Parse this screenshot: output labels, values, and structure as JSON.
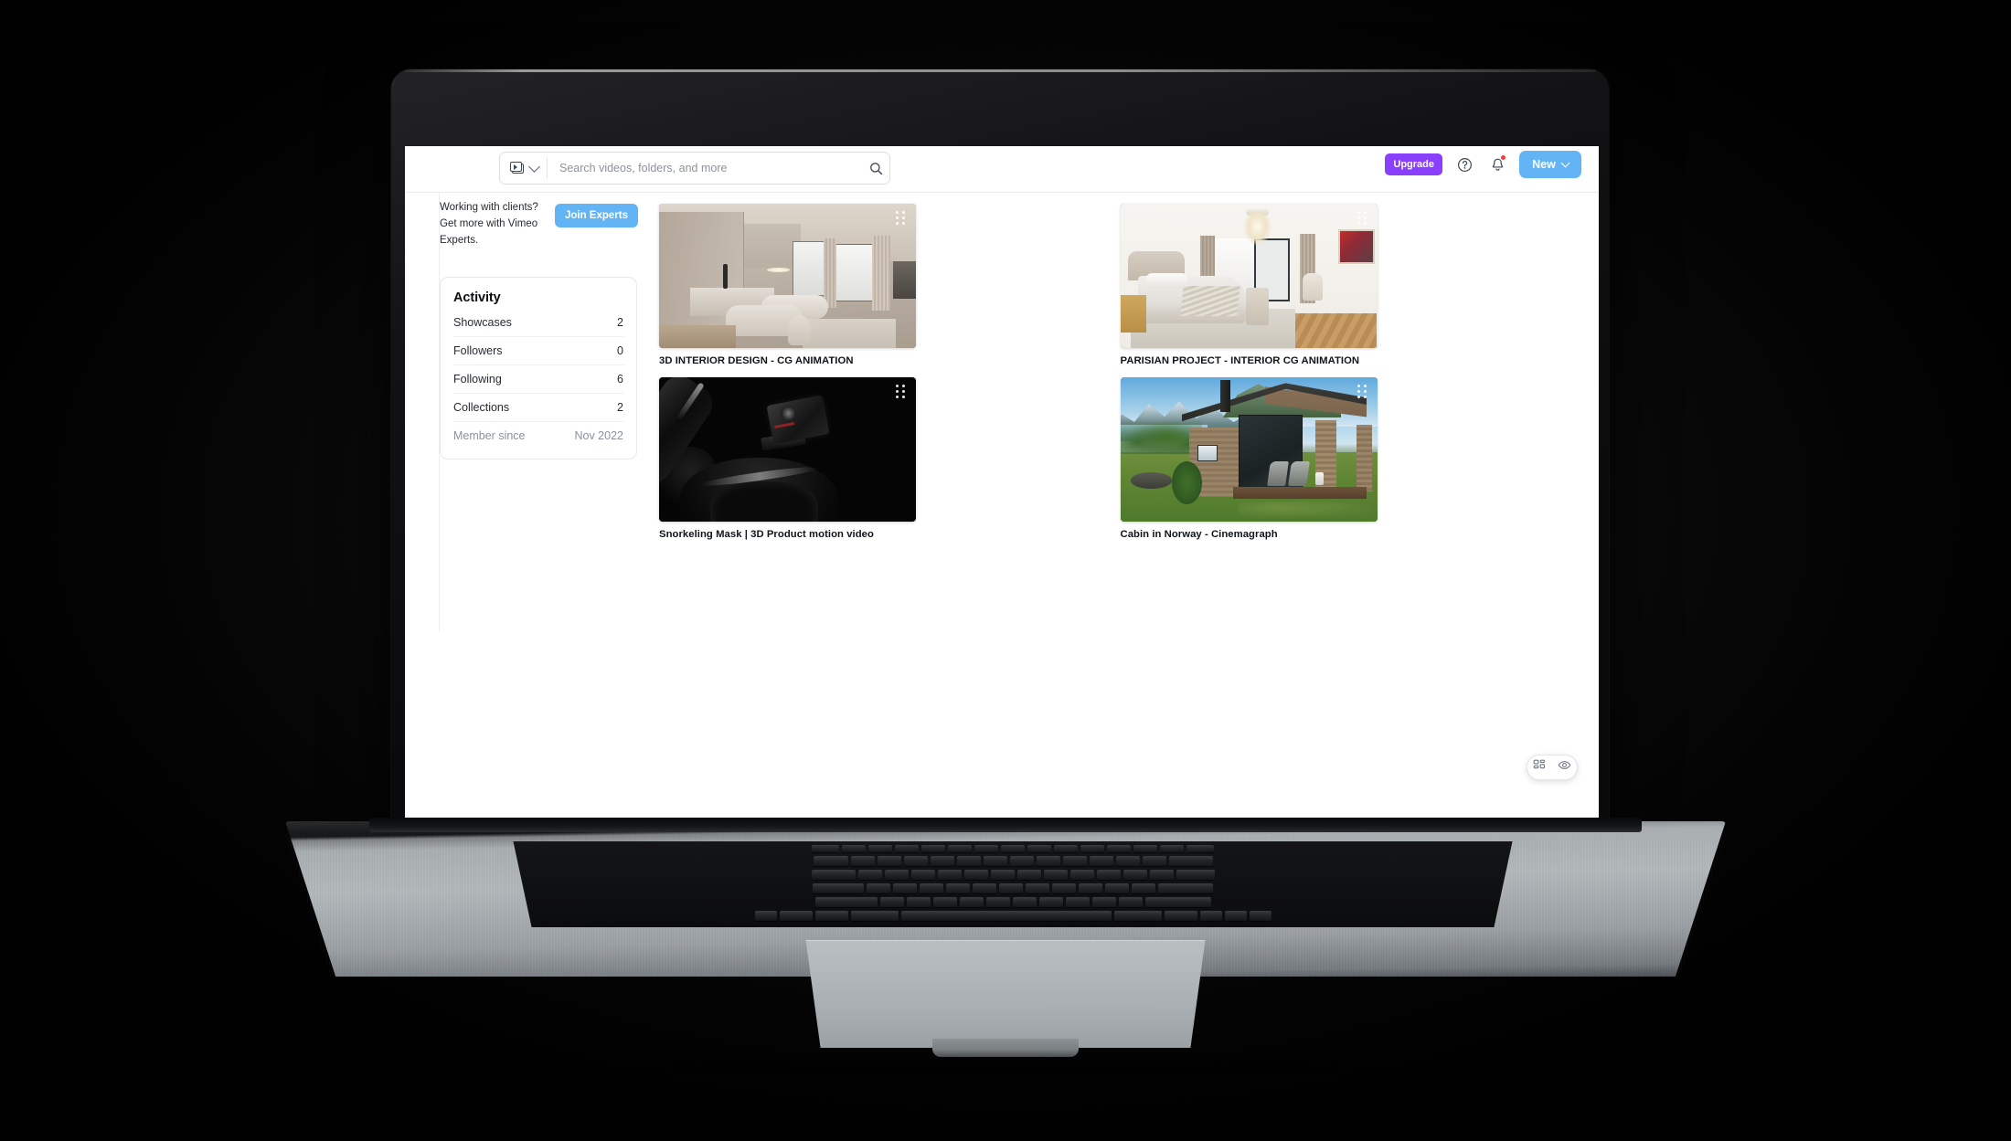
{
  "topbar": {
    "filter_icon": "video-stack-icon",
    "filter_chevron_icon": "chevron-down-icon",
    "search_placeholder": "Search videos, folders, and more",
    "search_value": "",
    "search_icon": "search-icon",
    "upgrade_label": "Upgrade",
    "help_icon": "question-circle-icon",
    "notifications_icon": "bell-icon",
    "new_label": "New",
    "new_chevron_icon": "chevron-down-icon"
  },
  "sidebar": {
    "promo_text": "Working with clients? Get more with Vimeo Experts.",
    "promo_button": "Join Experts",
    "activity": {
      "title": "Activity",
      "rows": [
        {
          "label": "Showcases",
          "value": "2"
        },
        {
          "label": "Followers",
          "value": "0"
        },
        {
          "label": "Following",
          "value": "6"
        },
        {
          "label": "Collections",
          "value": "2"
        }
      ],
      "member_since_label": "Member since",
      "member_since_value": "Nov 2022"
    }
  },
  "videos": [
    {
      "title": "3D INTERIOR DESIGN - CG ANIMATION",
      "drag_icon": "drag-handle-icon"
    },
    {
      "title": "PARISIAN PROJECT - INTERIOR CG ANIMATION",
      "drag_icon": "drag-handle-icon"
    },
    {
      "title": "Snorkeling Mask | 3D Product motion video",
      "drag_icon": "drag-handle-icon"
    },
    {
      "title": "Cabin in Norway - Cinemagraph",
      "drag_icon": "drag-handle-icon"
    }
  ],
  "floating_toolbar": {
    "grid_view_icon": "grid-layout-icon",
    "preview_icon": "eye-icon"
  },
  "colors": {
    "upgrade_purple": "#8a3ffc",
    "action_blue": "#63b4f5",
    "notification_red": "#ef3d3d",
    "page_background": "#ffffff",
    "text_primary": "#10151c"
  }
}
